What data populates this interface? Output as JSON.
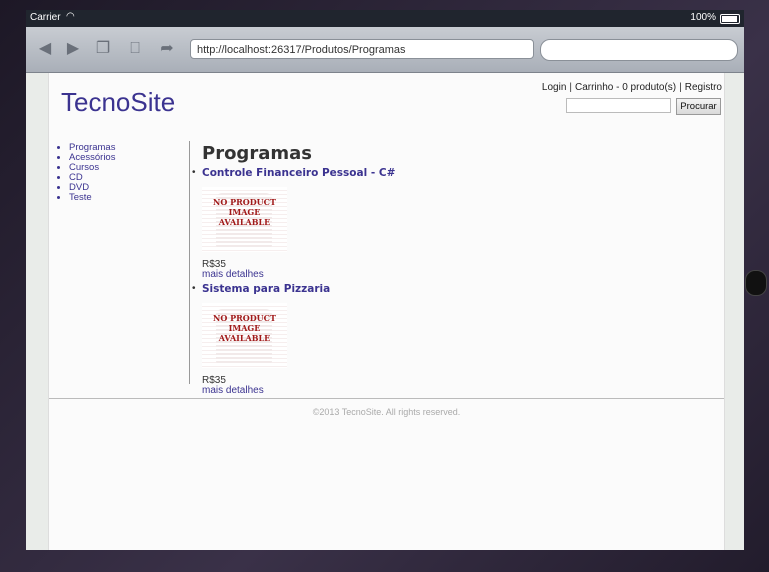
{
  "statusbar": {
    "carrier": "Carrier",
    "time": "",
    "battery": "100%"
  },
  "browser": {
    "url": "http://localhost:26317/Produtos/Programas",
    "search_placeholder": ""
  },
  "site": {
    "logo": "TecnoSite",
    "header_links": {
      "login": "Login",
      "cart": "Carrinho - 0 produto(s)",
      "register": "Registro"
    },
    "search_button": "Procurar",
    "nav": [
      "Programas",
      "Acessórios",
      "Cursos",
      "CD",
      "DVD",
      "Teste"
    ],
    "page_title": "Programas",
    "products": [
      {
        "name": "Controle Financeiro Pessoal - C#",
        "image_text": "NO PRODUCT IMAGE AVAILABLE",
        "price": "R$35",
        "details": "mais detalhes"
      },
      {
        "name": "Sistema para Pizzaria",
        "image_text": "NO PRODUCT IMAGE AVAILABLE",
        "price": "R$35",
        "details": "mais detalhes"
      }
    ],
    "footer": "©2013 TecnoSite. All rights reserved."
  },
  "colors": {
    "brand": "#3b3390",
    "placeholder_text": "#a11a1a"
  }
}
